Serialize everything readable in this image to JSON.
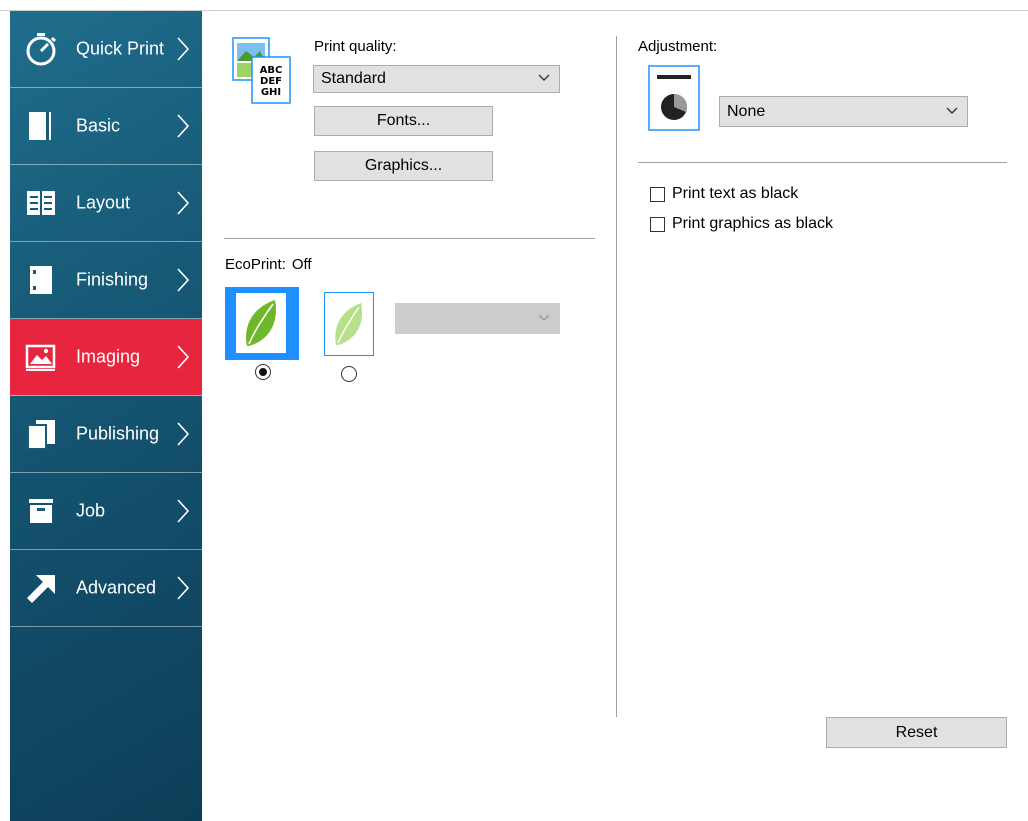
{
  "colors": {
    "sidebar": "#175b78",
    "active_item": "#e8253f",
    "selection": "#1e90ff",
    "button_bg": "#e1e1e1",
    "leaf_green": "#6fb82b"
  },
  "sidebar": {
    "items": [
      {
        "label": "Quick Print",
        "icon": "stopwatch-icon",
        "active": false
      },
      {
        "label": "Basic",
        "icon": "book-icon",
        "active": false
      },
      {
        "label": "Layout",
        "icon": "layout-grid-icon",
        "active": false
      },
      {
        "label": "Finishing",
        "icon": "finishing-icon",
        "active": false
      },
      {
        "label": "Imaging",
        "icon": "picture-icon",
        "active": true
      },
      {
        "label": "Publishing",
        "icon": "publishing-icon",
        "active": false
      },
      {
        "label": "Job",
        "icon": "job-box-icon",
        "active": false
      },
      {
        "label": "Advanced",
        "icon": "arrow-up-right-icon",
        "active": false
      }
    ]
  },
  "print_quality": {
    "label": "Print quality:",
    "icon": "text-quality-icon",
    "selected": "Standard",
    "fonts_button": "Fonts...",
    "graphics_button": "Graphics..."
  },
  "ecoprint": {
    "label": "EcoPrint:",
    "status": "Off",
    "options": [
      {
        "icon": "leaf-full-icon",
        "selected": true
      },
      {
        "icon": "leaf-light-icon",
        "selected": false
      }
    ],
    "level_value": ""
  },
  "adjustment": {
    "label": "Adjustment:",
    "icon": "contrast-pie-icon",
    "selected": "None"
  },
  "options": {
    "print_text_black": {
      "label": "Print text as black",
      "checked": false
    },
    "print_graphics_black": {
      "label": "Print graphics as black",
      "checked": false
    }
  },
  "reset_button": "Reset"
}
